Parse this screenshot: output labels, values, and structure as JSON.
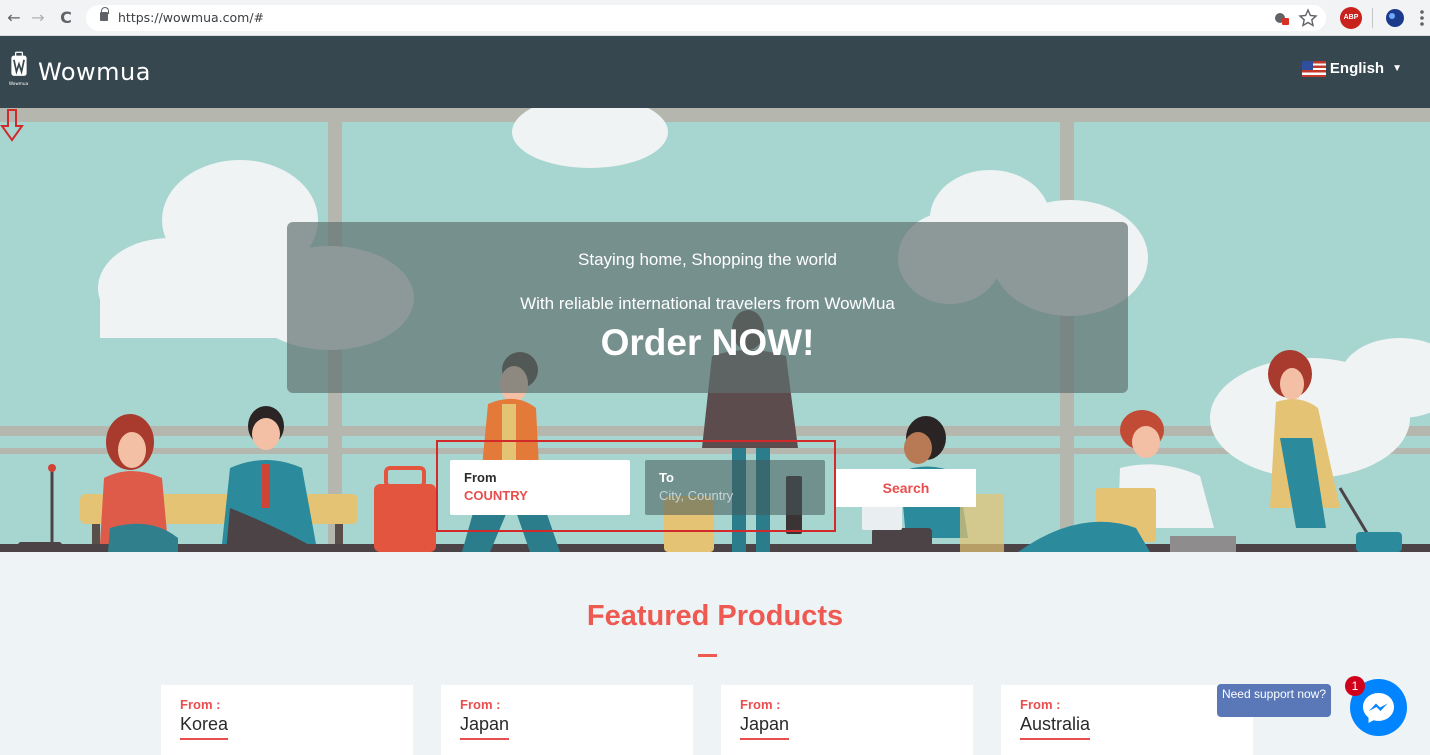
{
  "browser": {
    "url": "https://wowmua.com/#",
    "back_icon": "←",
    "forward_icon": "→",
    "reload_icon": "C",
    "extension_abp": "ABP"
  },
  "header": {
    "logo_text": "Wowmua",
    "logo_subtext": "Wowmua",
    "language": "English"
  },
  "hero": {
    "line1": "Staying home, Shopping the world",
    "line2": "With reliable international travelers from WowMua",
    "cta": "Order NOW!",
    "from_label": "From",
    "from_value": "COUNTRY",
    "to_label": "To",
    "to_placeholder": "City, Country",
    "search_label": "Search"
  },
  "featured": {
    "title": "Featured Products",
    "cards": [
      {
        "from_label": "From :",
        "country": "Korea"
      },
      {
        "from_label": "From :",
        "country": "Japan"
      },
      {
        "from_label": "From :",
        "country": "Japan"
      },
      {
        "from_label": "From :",
        "country": "Australia"
      }
    ]
  },
  "support": {
    "label": "Need support now?",
    "badge": "1"
  },
  "colors": {
    "accent": "#ee5a52",
    "header_bg": "#36474f",
    "hero_bg": "#a7d6d1",
    "messenger": "#0084ff"
  }
}
